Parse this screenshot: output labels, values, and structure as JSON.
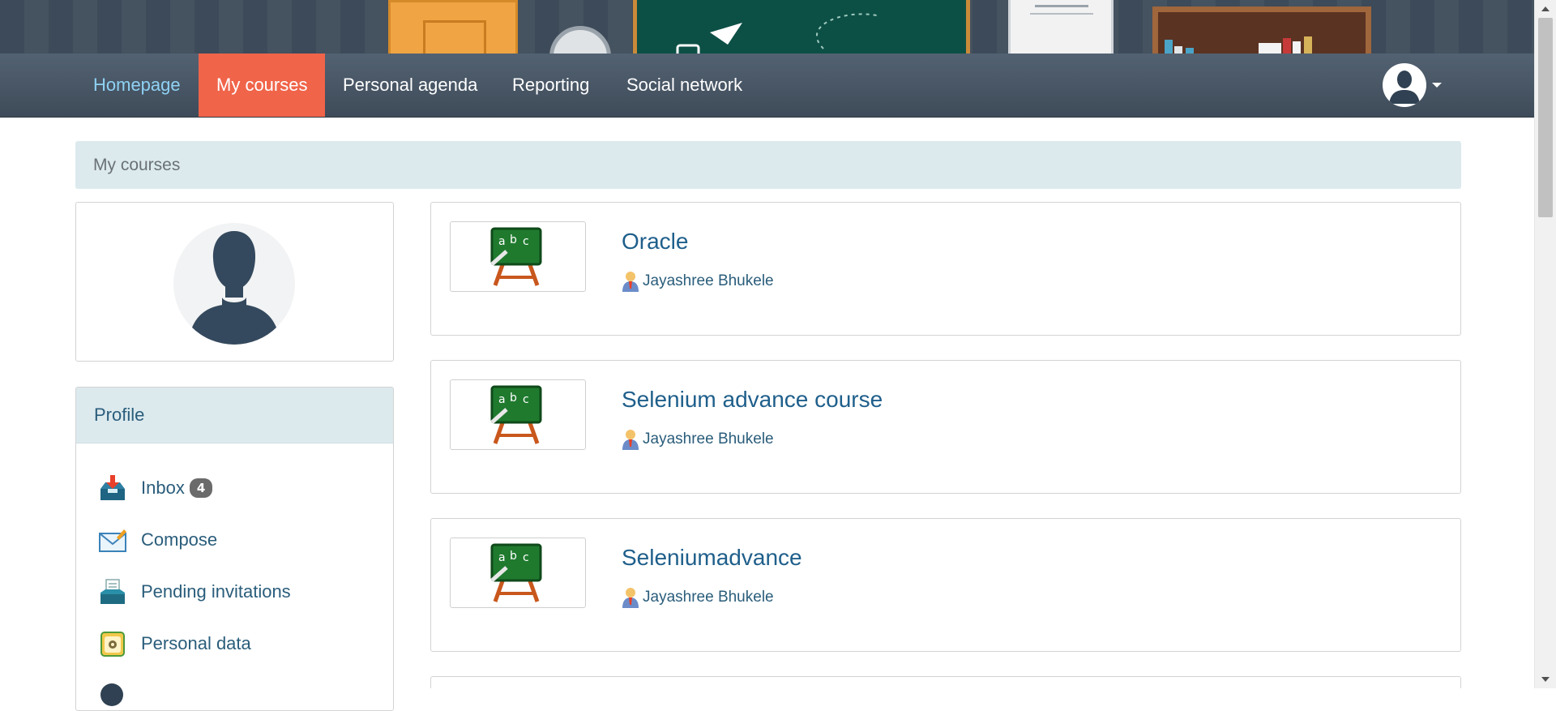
{
  "nav": {
    "items": [
      {
        "label": "Homepage"
      },
      {
        "label": "My courses"
      },
      {
        "label": "Personal agenda"
      },
      {
        "label": "Reporting"
      },
      {
        "label": "Social network"
      }
    ],
    "active_index": 1
  },
  "breadcrumb": {
    "label": "My courses"
  },
  "profile": {
    "title": "Profile",
    "items": [
      {
        "label": "Inbox",
        "badge": "4",
        "icon": "inbox-icon"
      },
      {
        "label": "Compose",
        "icon": "envelope-icon"
      },
      {
        "label": "Pending invitations",
        "icon": "invitation-icon"
      },
      {
        "label": "Personal data",
        "icon": "personal-data-icon"
      }
    ]
  },
  "courses": [
    {
      "title": "Oracle",
      "teacher": "Jayashree Bhukele"
    },
    {
      "title": "Selenium advance course",
      "teacher": "Jayashree Bhukele"
    },
    {
      "title": "Seleniumadvance",
      "teacher": "Jayashree Bhukele"
    }
  ],
  "colors": {
    "navbar": "#46535f",
    "active_tab": "#f0644a",
    "homepage_link": "#8fd2f4",
    "breadcrumb_bg": "#dceaee",
    "link": "#1f5f8b"
  }
}
